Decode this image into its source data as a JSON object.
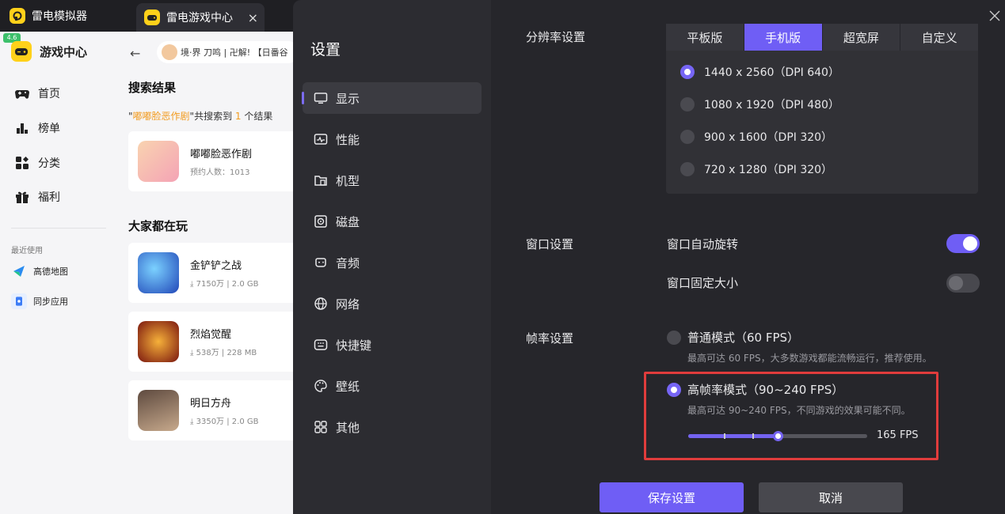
{
  "tabs": [
    {
      "label": "雷电模拟器"
    },
    {
      "label": "雷电游戏中心",
      "close": "×"
    }
  ],
  "sidebar": {
    "badge": "4.6",
    "brand": "游戏中心",
    "items": [
      {
        "label": "首页",
        "icon": "gamepad-icon"
      },
      {
        "label": "榜单",
        "icon": "bar-chart-icon"
      },
      {
        "label": "分类",
        "icon": "category-icon"
      },
      {
        "label": "福利",
        "icon": "gift-icon"
      }
    ],
    "recent_title": "最近使用",
    "recent": [
      {
        "label": "高德地图",
        "icon": "amap-icon"
      },
      {
        "label": "同步应用",
        "icon": "sync-app-icon"
      }
    ]
  },
  "content": {
    "back": "←",
    "search_text": "境·界 刀鸣 | 卍解! 【日番谷",
    "search_title": "搜索结果",
    "result_prefix": "\"",
    "result_keyword": "嘟嘟脸恶作剧",
    "result_mid": "\"共搜索到 ",
    "result_count": "1",
    "result_suffix": " 个结果",
    "result_card": {
      "name": "嘟嘟脸恶作剧",
      "sub": "预约人数：1013"
    },
    "popular_title": "大家都在玩",
    "popular": [
      {
        "name": "金铲铲之战",
        "downloads": "7150万",
        "size": "2.0 GB"
      },
      {
        "name": "烈焰觉醒",
        "downloads": "538万",
        "size": "228 MB"
      },
      {
        "name": "明日方舟",
        "downloads": "3350万",
        "size": "2.0 GB"
      }
    ]
  },
  "settings": {
    "title": "设置",
    "menu": [
      {
        "label": "显示",
        "icon": "monitor-icon",
        "active": true
      },
      {
        "label": "性能",
        "icon": "performance-icon"
      },
      {
        "label": "机型",
        "icon": "device-model-icon"
      },
      {
        "label": "磁盘",
        "icon": "disk-icon"
      },
      {
        "label": "音频",
        "icon": "audio-icon"
      },
      {
        "label": "网络",
        "icon": "network-icon"
      },
      {
        "label": "快捷键",
        "icon": "keyboard-icon"
      },
      {
        "label": "壁纸",
        "icon": "palette-icon"
      },
      {
        "label": "其他",
        "icon": "grid-icon"
      }
    ],
    "resolution": {
      "label": "分辨率设置",
      "tabs": [
        "平板版",
        "手机版",
        "超宽屏",
        "自定义"
      ],
      "active_tab": "手机版",
      "options": [
        {
          "label": "1440 x 2560（DPI 640）",
          "selected": true
        },
        {
          "label": "1080 x 1920（DPI 480）",
          "selected": false
        },
        {
          "label": "900 x 1600（DPI 320）",
          "selected": false
        },
        {
          "label": "720 x 1280（DPI 320）",
          "selected": false
        }
      ]
    },
    "window": {
      "label": "窗口设置",
      "auto_rotate": {
        "label": "窗口自动旋转",
        "on": true
      },
      "fixed_size": {
        "label": "窗口固定大小",
        "on": false
      }
    },
    "fps": {
      "label": "帧率设置",
      "normal": {
        "title": "普通模式（60 FPS）",
        "desc": "最高可达 60 FPS，大多数游戏都能流畅运行，推荐使用。",
        "selected": false
      },
      "high": {
        "title": "高帧率模式（90~240 FPS）",
        "desc": "最高可达 90~240 FPS，不同游戏的效果可能不同。",
        "selected": true
      },
      "slider": {
        "min": 90,
        "max": 240,
        "value": 165,
        "unit_label": "165 FPS",
        "ticks": [
          120,
          144
        ]
      }
    },
    "save_label": "保存设置",
    "cancel_label": "取消"
  },
  "colors": {
    "accent": "#6f5ef5",
    "highlight": "#e03c3c",
    "brand_yellow": "#ffd11a"
  }
}
